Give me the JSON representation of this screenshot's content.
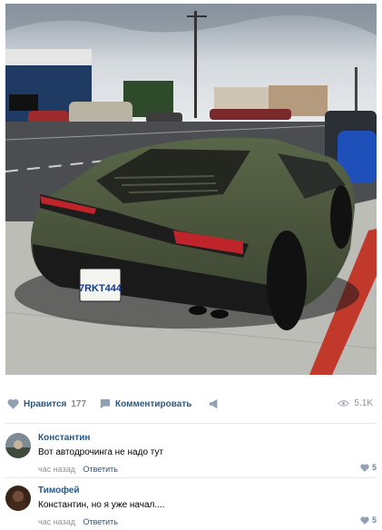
{
  "post": {
    "photo": {
      "license_plate": "7RKT444",
      "colors": {
        "car_body": "#48533a",
        "sky": "#c7cdd3",
        "road": "#4b4d50",
        "curb_red": "#c0392b"
      }
    },
    "actions": {
      "like_label": "Нравится",
      "like_count": "177",
      "comment_label": "Комментировать",
      "views_count": "5.1K"
    }
  },
  "comments": [
    {
      "author": "Константин",
      "text": "Вот автодрочинга не надо тут",
      "time": "час назад",
      "reply_label": "Ответить",
      "likes": "5"
    },
    {
      "author": "Тимофей",
      "text": "Константин, но я уже начал....",
      "time": "час назад",
      "reply_label": "Ответить",
      "likes": "5"
    }
  ],
  "theme": {
    "link": "#2a5885",
    "muted": "#939393",
    "icon": "#8fa1b3"
  }
}
